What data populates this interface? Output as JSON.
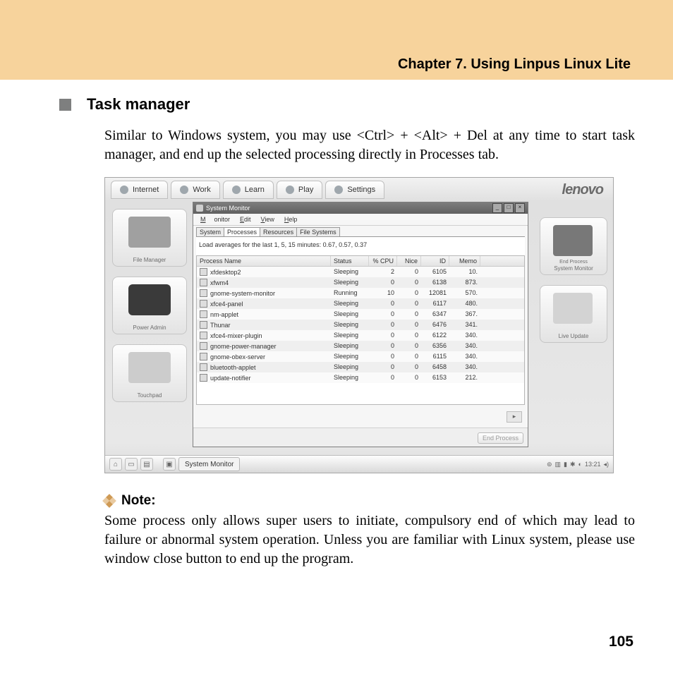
{
  "chapter_title": "Chapter 7. Using Linpus Linux Lite",
  "section_title": "Task manager",
  "intro_para": "Similar to Windows system, you may use <Ctrl> + <Alt> + Del at any time to start task manager, and end up the selected processing directly in Processes tab.",
  "note_label": "Note:",
  "note_para": "Some process only allows super users to initiate, compulsory end of which may lead to failure or abnormal system operation. Unless you are familiar with Linux system, please use window close button to end up the program.",
  "page_number": "105",
  "screenshot": {
    "top_tabs": [
      "Internet",
      "Work",
      "Learn",
      "Play",
      "Settings"
    ],
    "brand": "lenovo",
    "left_icons": [
      {
        "label": "File Manager"
      },
      {
        "label": "Power Admin"
      },
      {
        "label": "Touchpad"
      }
    ],
    "right_icons": [
      {
        "label": "System Monitor",
        "caption": "End Process"
      },
      {
        "label": "Live Update"
      }
    ],
    "window": {
      "title": "System Monitor",
      "menus": [
        "Monitor",
        "Edit",
        "View",
        "Help"
      ],
      "subtabs": [
        "System",
        "Processes",
        "Resources",
        "File Systems"
      ],
      "active_subtab": 1,
      "load_text": "Load averages for the last 1, 5, 15 minutes: 0.67, 0.57, 0.37",
      "columns": [
        "Process Name",
        "Status",
        "% CPU",
        "Nice",
        "ID",
        "Memo"
      ],
      "rows": [
        {
          "name": "xfdesktop2",
          "status": "Sleeping",
          "cpu": "2",
          "nice": "0",
          "id": "6105",
          "mem": "10."
        },
        {
          "name": "xfwm4",
          "status": "Sleeping",
          "cpu": "0",
          "nice": "0",
          "id": "6138",
          "mem": "873."
        },
        {
          "name": "gnome-system-monitor",
          "status": "Running",
          "cpu": "10",
          "nice": "0",
          "id": "12081",
          "mem": "570."
        },
        {
          "name": "xfce4-panel",
          "status": "Sleeping",
          "cpu": "0",
          "nice": "0",
          "id": "6117",
          "mem": "480."
        },
        {
          "name": "nm-applet",
          "status": "Sleeping",
          "cpu": "0",
          "nice": "0",
          "id": "6347",
          "mem": "367."
        },
        {
          "name": "Thunar",
          "status": "Sleeping",
          "cpu": "0",
          "nice": "0",
          "id": "6476",
          "mem": "341."
        },
        {
          "name": "xfce4-mixer-plugin",
          "status": "Sleeping",
          "cpu": "0",
          "nice": "0",
          "id": "6122",
          "mem": "340."
        },
        {
          "name": "gnome-power-manager",
          "status": "Sleeping",
          "cpu": "0",
          "nice": "0",
          "id": "6356",
          "mem": "340."
        },
        {
          "name": "gnome-obex-server",
          "status": "Sleeping",
          "cpu": "0",
          "nice": "0",
          "id": "6115",
          "mem": "340."
        },
        {
          "name": "bluetooth-applet",
          "status": "Sleeping",
          "cpu": "0",
          "nice": "0",
          "id": "6458",
          "mem": "340."
        },
        {
          "name": "update-notifier",
          "status": "Sleeping",
          "cpu": "0",
          "nice": "0",
          "id": "6153",
          "mem": "212."
        }
      ],
      "end_button": "End Process"
    },
    "taskbar": {
      "task_label": "System Monitor",
      "clock": "13:21"
    }
  }
}
